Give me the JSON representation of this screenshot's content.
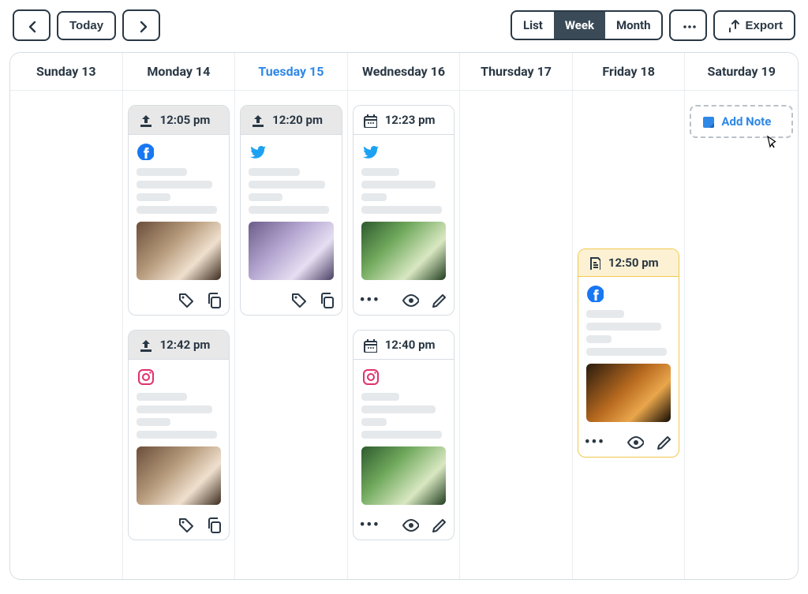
{
  "toolbar": {
    "today_label": "Today",
    "views": {
      "list": "List",
      "week": "Week",
      "month": "Month",
      "active": "Week"
    },
    "export_label": "Export"
  },
  "calendar": {
    "days": [
      {
        "label": "Sunday 13",
        "active": false
      },
      {
        "label": "Monday 14",
        "active": false
      },
      {
        "label": "Tuesday 15",
        "active": true
      },
      {
        "label": "Wednesday 16",
        "active": false
      },
      {
        "label": "Thursday 17",
        "active": false
      },
      {
        "label": "Friday 18",
        "active": false
      },
      {
        "label": "Saturday 19",
        "active": false
      }
    ]
  },
  "columns": {
    "sunday": [],
    "monday": [
      {
        "time": "12:05 pm",
        "status_icon": "upload-icon",
        "header_style": "gray",
        "platform": "facebook",
        "thumb": "cappuccino",
        "actions": [
          "tag",
          "copy"
        ]
      },
      {
        "time": "12:42 pm",
        "status_icon": "upload-icon",
        "header_style": "gray",
        "platform": "instagram",
        "thumb": "cappuccino",
        "actions": [
          "tag",
          "copy"
        ]
      }
    ],
    "tuesday": [
      {
        "time": "12:20 pm",
        "status_icon": "upload-icon",
        "header_style": "gray",
        "platform": "twitter",
        "thumb": "lilac",
        "actions": [
          "tag",
          "copy"
        ]
      }
    ],
    "wednesday": [
      {
        "time": "12:23 pm",
        "status_icon": "calendar-icon",
        "header_style": "light",
        "platform": "twitter",
        "thumb": "matcha",
        "actions": [
          "more",
          "eye",
          "edit"
        ]
      },
      {
        "time": "12:40 pm",
        "status_icon": "calendar-icon",
        "header_style": "light",
        "platform": "instagram",
        "thumb": "matcha",
        "actions": [
          "more",
          "eye",
          "edit"
        ]
      }
    ],
    "thursday": [],
    "friday": [
      {
        "time": "12:50 pm",
        "status_icon": "note-icon",
        "header_style": "note",
        "platform": "facebook",
        "thumb": "whiskey",
        "actions": [
          "more",
          "eye",
          "edit"
        ],
        "is_note": true
      }
    ],
    "saturday": {
      "add_note_label": "Add Note"
    }
  },
  "icons": {
    "facebook_color": "#1877F2",
    "twitter_color": "#1DA1F2",
    "instagram_color": "#E1306C"
  }
}
